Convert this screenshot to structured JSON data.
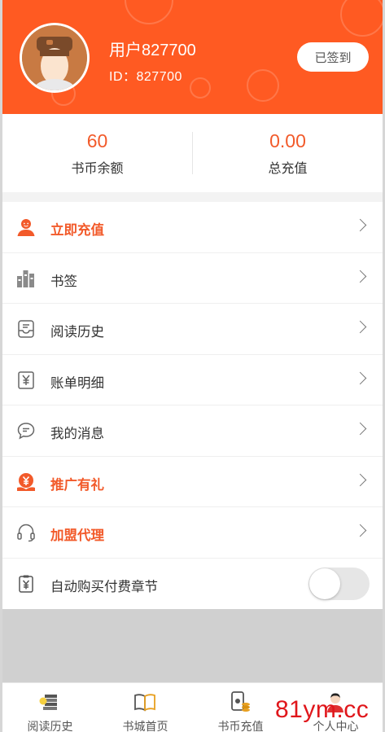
{
  "header": {
    "username": "用户827700",
    "user_id": "ID：827700",
    "signin_label": "已签到",
    "bg_color": "#ff5a22"
  },
  "stats": {
    "balance_value": "60",
    "balance_label": "书币余额",
    "total_value": "0.00",
    "total_label": "总充值"
  },
  "menu": {
    "items": [
      {
        "label": "立即充值",
        "icon": "user-icon",
        "highlight": true
      },
      {
        "label": "书签",
        "icon": "bookmark-bars-icon",
        "highlight": false
      },
      {
        "label": "阅读历史",
        "icon": "history-tray-icon",
        "highlight": false
      },
      {
        "label": "账单明细",
        "icon": "bill-icon",
        "highlight": false
      },
      {
        "label": "我的消息",
        "icon": "message-bubble-icon",
        "highlight": false
      },
      {
        "label": "推广有礼",
        "icon": "gift-coin-icon",
        "highlight": true
      },
      {
        "label": "加盟代理",
        "icon": "headset-icon",
        "highlight": true
      },
      {
        "label": "自动购买付费章节",
        "icon": "clipboard-yen-icon",
        "highlight": false
      }
    ],
    "auto_buy_enabled": false
  },
  "tabbar": {
    "tabs": [
      {
        "label": "阅读历史",
        "icon": "reading-history-icon"
      },
      {
        "label": "书城首页",
        "icon": "open-book-icon"
      },
      {
        "label": "书币充值",
        "icon": "phone-coins-icon"
      },
      {
        "label": "个人中心",
        "icon": "person-avatar-icon"
      }
    ]
  },
  "watermark": "81ym.cc",
  "colors": {
    "accent": "#f25a2a",
    "watermark": "#e0161b"
  }
}
